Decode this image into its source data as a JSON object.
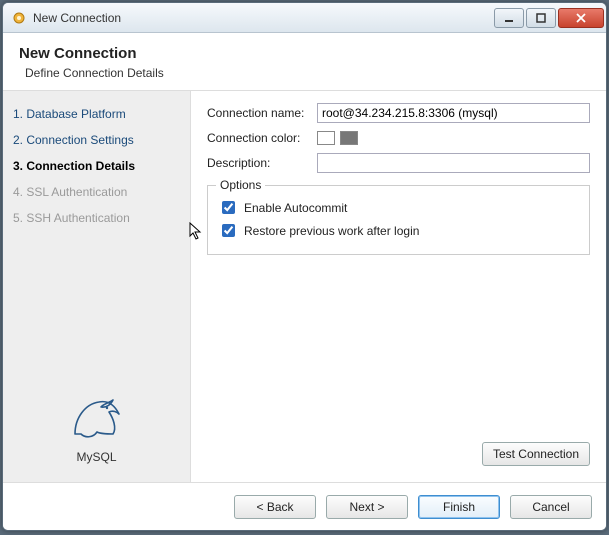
{
  "window": {
    "title": "New Connection"
  },
  "header": {
    "title": "New Connection",
    "subtitle": "Define Connection Details"
  },
  "sidebar": {
    "steps": [
      {
        "label": "1. Database Platform",
        "state": "normal"
      },
      {
        "label": "2. Connection Settings",
        "state": "normal"
      },
      {
        "label": "3. Connection Details",
        "state": "active"
      },
      {
        "label": "4. SSL Authentication",
        "state": "disabled"
      },
      {
        "label": "5. SSH Authentication",
        "state": "disabled"
      }
    ],
    "db": {
      "name": "MySQL",
      "logo": "dolphin-icon"
    }
  },
  "form": {
    "connection_name_label": "Connection name:",
    "connection_name_value": "root@34.234.215.8:3306 (mysql)",
    "connection_color_label": "Connection color:",
    "description_label": "Description:",
    "description_value": "",
    "options_label": "Options",
    "enable_autocommit_label": "Enable Autocommit",
    "enable_autocommit_checked": true,
    "restore_previous_label": "Restore previous work after login",
    "restore_previous_checked": true
  },
  "buttons": {
    "test_connection": "Test Connection",
    "back": "< Back",
    "next": "Next >",
    "finish": "Finish",
    "cancel": "Cancel"
  }
}
